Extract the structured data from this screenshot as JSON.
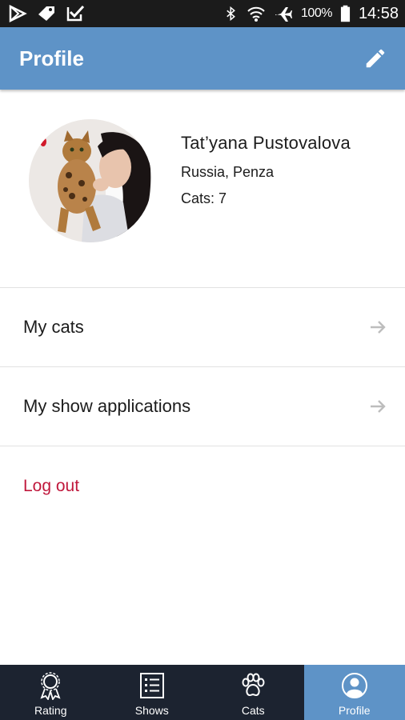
{
  "status_bar": {
    "left_icons": [
      "play-store-icon",
      "tag-icon",
      "checkbox-icon"
    ],
    "right_icons": [
      "bluetooth-icon",
      "wifi-icon",
      "airplane-icon",
      "battery-icon"
    ],
    "battery": "100%",
    "time": "14:58"
  },
  "appbar": {
    "title": "Profile",
    "edit_icon": "pencil-icon",
    "color": "#5e93c7"
  },
  "profile": {
    "name": "Tat’yana Pustovalova",
    "location": "Russia, Penza",
    "cats": "Cats: 7"
  },
  "menu": {
    "items": [
      {
        "label": "My cats",
        "icon": "arrow-right-icon"
      },
      {
        "label": "My show applications",
        "icon": "arrow-right-icon"
      }
    ],
    "logout": "Log out",
    "logout_color": "#c0183c"
  },
  "bottom_nav": {
    "items": [
      {
        "label": "Rating",
        "icon": "ribbon-award-icon",
        "active": false
      },
      {
        "label": "Shows",
        "icon": "list-icon",
        "active": false
      },
      {
        "label": "Cats",
        "icon": "paw-icon",
        "active": false
      },
      {
        "label": "Profile",
        "icon": "person-icon",
        "active": true
      }
    ],
    "background": "#1c2330",
    "active_color": "#5e93c7"
  }
}
